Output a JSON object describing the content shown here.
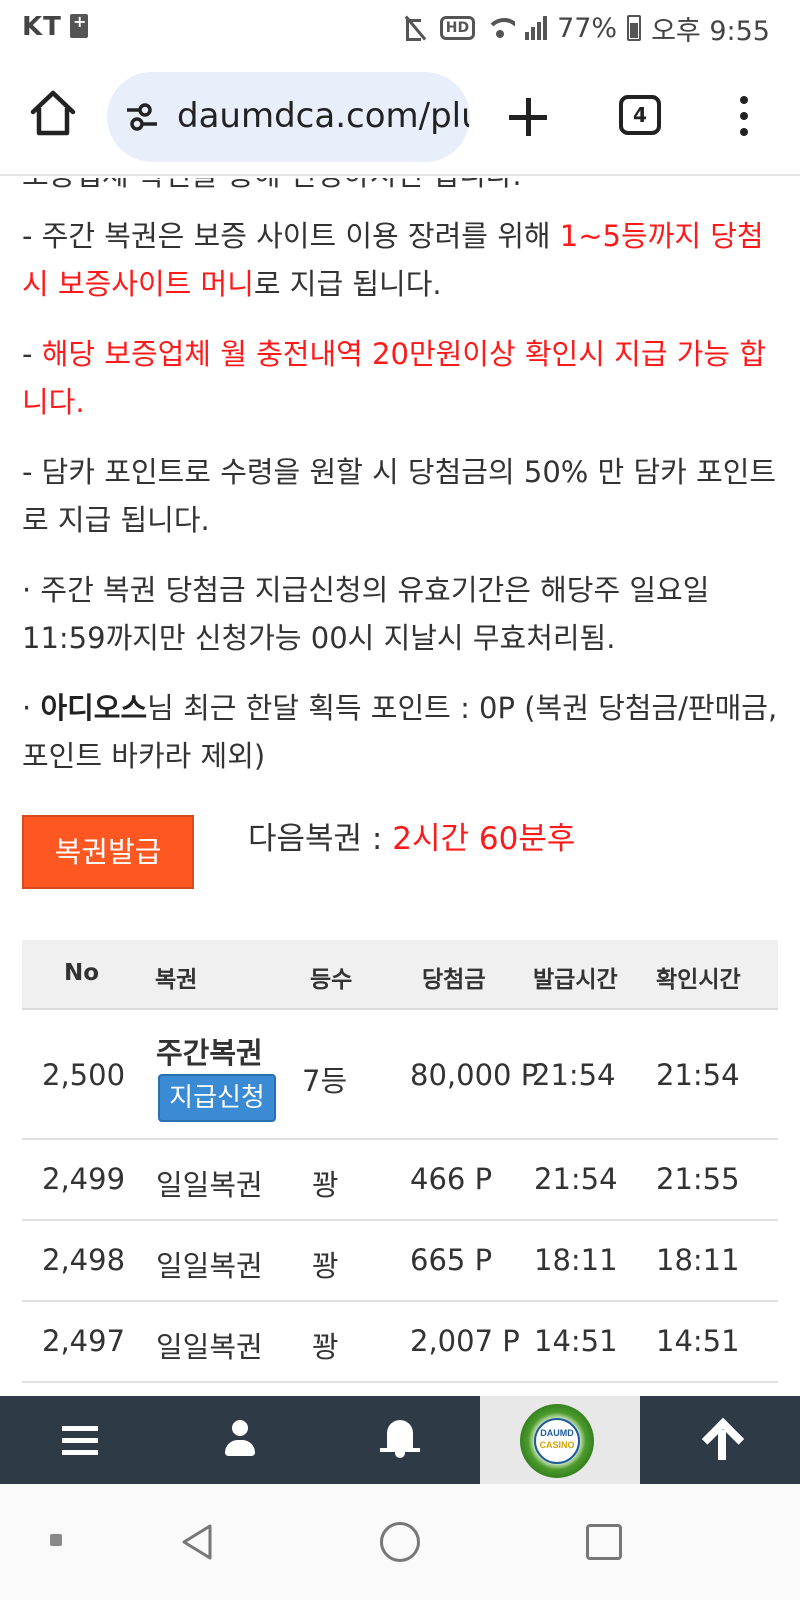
{
  "status_bar": {
    "carrier": "KT",
    "battery": "77%",
    "time": "오후 9:55",
    "icons": [
      "sim-icon",
      "mute-icon",
      "hd-icon",
      "wifi-icon",
      "signal-icon",
      "battery-icon"
    ]
  },
  "browser": {
    "url": "daumdca.com/plu",
    "tab_count": "4",
    "icons": [
      "home-icon",
      "site-settings-icon",
      "new-tab-icon",
      "tabs-icon",
      "more-menu-icon"
    ]
  },
  "content": {
    "cut_top_line": "보증업체 확인을 통해 신청하시면 됩니다.",
    "p1": {
      "prefix": "  - 주간 복권은 보증 사이트 이용 장려를 위해 ",
      "red1": "1~5등까지 당첨 시 보증사이트 머니",
      "suffix": "로 지급 됩니다."
    },
    "p2": {
      "prefix": "  - ",
      "red": "해당 보증업체 월 충전내역 20만원이상 확인시 지급 가능 합니다."
    },
    "p3": "  - 담카 포인트로 수령을 원할 시 당첨금의 50% 만 담카 포인트로 지급 됩니다.",
    "p4": " · 주간 복권 당첨금 지급신청의 유효기간은 해당주 일요일 11:59까지만 신청가능 00시 지날시 무효처리됨.",
    "p5": {
      "prefix": " · ",
      "user": "아디오스",
      "suffix": "님 최근 한달 획득 포인트 : 0P (복권 당첨금/판매금, 포인트 바카라 제외)"
    },
    "issue_button": "복권발급",
    "next_lottery_label": "다음복권 : ",
    "next_lottery_value": "2시간 60분후"
  },
  "table": {
    "headers": [
      "No",
      "복권",
      "등수",
      "당첨금",
      "발급시간",
      "확인시간"
    ],
    "rows": [
      {
        "no": "2,500",
        "lottery": "주간복권",
        "claim": "지급신청",
        "rank": "7등",
        "prize": "80,000 P",
        "issued": "21:54",
        "checked": "21:54"
      },
      {
        "no": "2,499",
        "lottery": "일일복권",
        "rank": "꽝",
        "prize": "466 P",
        "issued": "21:54",
        "checked": "21:55"
      },
      {
        "no": "2,498",
        "lottery": "일일복권",
        "rank": "꽝",
        "prize": "665 P",
        "issued": "18:11",
        "checked": "18:11"
      },
      {
        "no": "2,497",
        "lottery": "일일복권",
        "rank": "꽝",
        "prize": "2,007 P",
        "issued": "14:51",
        "checked": "14:51"
      }
    ]
  },
  "bottom_nav": {
    "items": [
      "menu-icon",
      "user-icon",
      "bell-icon",
      "daumd-casino-logo",
      "arrow-up-icon"
    ],
    "logo_line1": "DAUMD",
    "logo_line2": "CASINO"
  },
  "colors": {
    "accent_red": "#ff1a1a",
    "issue_button": "#ff5722",
    "claim_button": "#3b8bd4",
    "nav_bg": "#2f3a47",
    "url_pill": "#e8eefa"
  }
}
